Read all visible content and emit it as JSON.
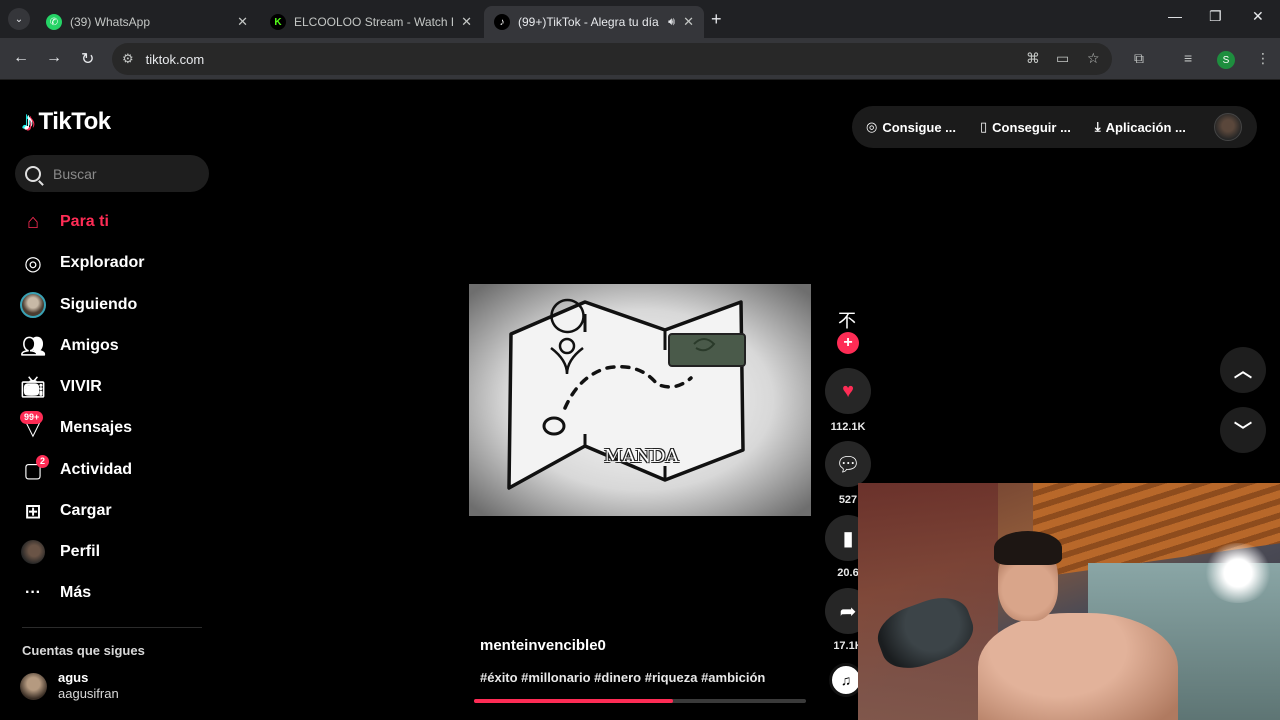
{
  "browser": {
    "tabs": [
      {
        "title": "(39) WhatsApp",
        "favicon": "whatsapp-icon",
        "active": false
      },
      {
        "title": "ELCOOLOO Stream - Watch Liv",
        "favicon": "kick-icon",
        "active": false
      },
      {
        "title": "(99+)TikTok - Alegra tu día",
        "favicon": "tiktok-icon",
        "active": true
      }
    ],
    "url": "tiktok.com",
    "profile_initial": "S"
  },
  "tiktok": {
    "logo": "TikTok",
    "search_placeholder": "Buscar",
    "nav": [
      {
        "label": "Para ti",
        "icon": "home-icon",
        "active": true
      },
      {
        "label": "Explorador",
        "icon": "compass-icon"
      },
      {
        "label": "Siguiendo",
        "icon": "following-avatar-icon"
      },
      {
        "label": "Amigos",
        "icon": "friends-icon"
      },
      {
        "label": "VIVIR",
        "icon": "live-tv-icon"
      },
      {
        "label": "Mensajes",
        "icon": "messages-icon",
        "badge": "99+"
      },
      {
        "label": "Actividad",
        "icon": "activity-icon",
        "badge": "2"
      },
      {
        "label": "Cargar",
        "icon": "upload-icon"
      },
      {
        "label": "Perfil",
        "icon": "profile-avatar-icon"
      },
      {
        "label": "Más",
        "icon": "more-icon"
      }
    ],
    "following_title": "Cuentas que sigues",
    "following": [
      {
        "name": "agus",
        "handle": "aagusifran"
      }
    ],
    "top_buttons": [
      {
        "label": "Consigue ...",
        "icon": "coin-icon"
      },
      {
        "label": "Conseguir ...",
        "icon": "phone-icon"
      },
      {
        "label": "Aplicación ...",
        "icon": "download-icon"
      }
    ],
    "video": {
      "overlay_text": "MANDA",
      "creator": "menteinvencible0",
      "hashtags": "#éxito #millonario #dinero #riqueza #ambición",
      "likes": "112.1K",
      "comments": "527",
      "saves": "20.6",
      "shares": "17.1K",
      "progress": 0.6
    }
  }
}
